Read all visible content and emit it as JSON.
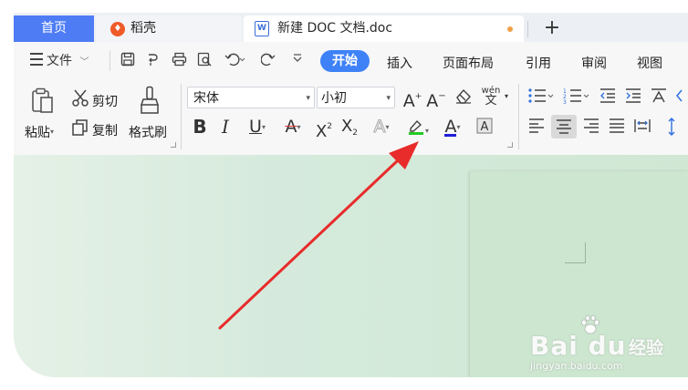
{
  "tabs": {
    "home": "首页",
    "daoke": "稻壳",
    "doc": "新建 DOC 文档.doc",
    "add": "+"
  },
  "menu": {
    "file": "文件",
    "tabs": [
      "开始",
      "插入",
      "页面布局",
      "引用",
      "审阅",
      "视图"
    ]
  },
  "ribbon": {
    "paste": "粘贴",
    "cut": "剪切",
    "copy": "复制",
    "format_painter": "格式刷",
    "font_name": "宋体",
    "font_size": "小初",
    "pinyin": "wén"
  },
  "watermark": {
    "brand": "Bai du",
    "jingyan": "经验",
    "url": "jingyan.baidu.com"
  },
  "colors": {
    "accent": "#3f82f7",
    "highlight_bar": "#22cc22",
    "font_color_bar": "#1f1fd6",
    "arrow": "#e82b2b"
  }
}
